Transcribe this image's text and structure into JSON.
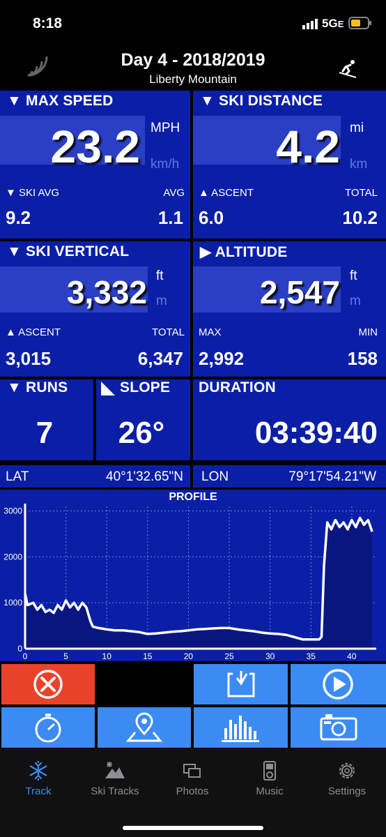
{
  "status_bar": {
    "time": "8:18",
    "network": "5G",
    "network_suffix": "E"
  },
  "header": {
    "title": "Day 4 - 2018/2019",
    "subtitle": "Liberty Mountain"
  },
  "max_speed": {
    "label": "▼ MAX SPEED",
    "value": "23.2",
    "unit_primary": "MPH",
    "unit_secondary": "km/h",
    "left_label": "▼ SKI AVG",
    "left_value": "9.2",
    "right_label": "AVG",
    "right_value": "1.1"
  },
  "ski_distance": {
    "label": "▼ SKI DISTANCE",
    "value": "4.2",
    "unit_primary": "mi",
    "unit_secondary": "km",
    "left_label": "▲ ASCENT",
    "left_value": "6.0",
    "right_label": "TOTAL",
    "right_value": "10.2"
  },
  "ski_vertical": {
    "label": "▼ SKI VERTICAL",
    "value": "3,332",
    "unit_primary": "ft",
    "unit_secondary": "m",
    "left_label": "▲ ASCENT",
    "left_value": "3,015",
    "right_label": "TOTAL",
    "right_value": "6,347"
  },
  "altitude": {
    "label": "▶ ALTITUDE",
    "value": "2,547",
    "unit_primary": "ft",
    "unit_secondary": "m",
    "left_label": "MAX",
    "left_value": "2,992",
    "right_label": "MIN",
    "right_value": "158"
  },
  "runs": {
    "label": "▼ RUNS",
    "value": "7"
  },
  "slope": {
    "label": "SLOPE",
    "value": "26°"
  },
  "duration": {
    "label": "DURATION",
    "value": "03:39:40"
  },
  "coords": {
    "lat_label": "LAT",
    "lat_value": "40°1'32.65\"N",
    "lon_label": "LON",
    "lon_value": "79°17'54.21\"W"
  },
  "chart_data": {
    "type": "area",
    "title": "PROFILE",
    "xlabel": "",
    "ylabel": "",
    "xlim": [
      0,
      43
    ],
    "ylim": [
      0,
      3100
    ],
    "x_ticks": [
      "0",
      "5",
      "10",
      "15",
      "20",
      "25",
      "30",
      "35",
      "40"
    ],
    "y_ticks": [
      "0",
      "1000",
      "2000",
      "3000"
    ],
    "grid": true,
    "x": [
      0,
      0.3,
      1,
      1.5,
      2,
      2.5,
      3,
      3.5,
      4,
      4.5,
      5,
      5.5,
      6,
      6.5,
      7,
      7.5,
      8,
      8.3,
      9,
      10,
      11,
      12,
      13,
      14,
      15,
      16,
      17,
      18,
      19,
      20,
      21,
      22,
      23,
      24,
      25,
      26,
      27,
      28,
      29,
      30,
      31,
      32,
      33,
      34,
      35,
      36,
      36.3,
      36.6,
      37,
      37.5,
      38,
      38.5,
      39,
      39.5,
      40,
      40.5,
      41,
      41.5,
      42,
      42.5
    ],
    "values": [
      1200,
      950,
      1000,
      850,
      950,
      800,
      850,
      780,
      950,
      850,
      1050,
      900,
      1000,
      850,
      1000,
      900,
      600,
      480,
      450,
      420,
      400,
      400,
      380,
      360,
      320,
      330,
      350,
      370,
      380,
      400,
      420,
      430,
      440,
      450,
      450,
      420,
      400,
      380,
      350,
      330,
      320,
      300,
      250,
      200,
      200,
      200,
      260,
      1800,
      2750,
      2600,
      2800,
      2650,
      2750,
      2600,
      2800,
      2650,
      2850,
      2700,
      2800,
      2550
    ]
  },
  "buttons": {
    "close": "close",
    "save": "save",
    "play": "play",
    "stopwatch": "stopwatch",
    "map": "map",
    "stats": "stats",
    "camera": "camera"
  },
  "tabs": [
    {
      "label": "Track"
    },
    {
      "label": "Ski Tracks"
    },
    {
      "label": "Photos"
    },
    {
      "label": "Music"
    },
    {
      "label": "Settings"
    }
  ],
  "colors": {
    "panel": "#0b1fa6",
    "value_box": "#2a3fc4",
    "button_blue": "#3b8bf2",
    "button_red": "#e8432a",
    "tab_active": "#3b8bf2"
  }
}
